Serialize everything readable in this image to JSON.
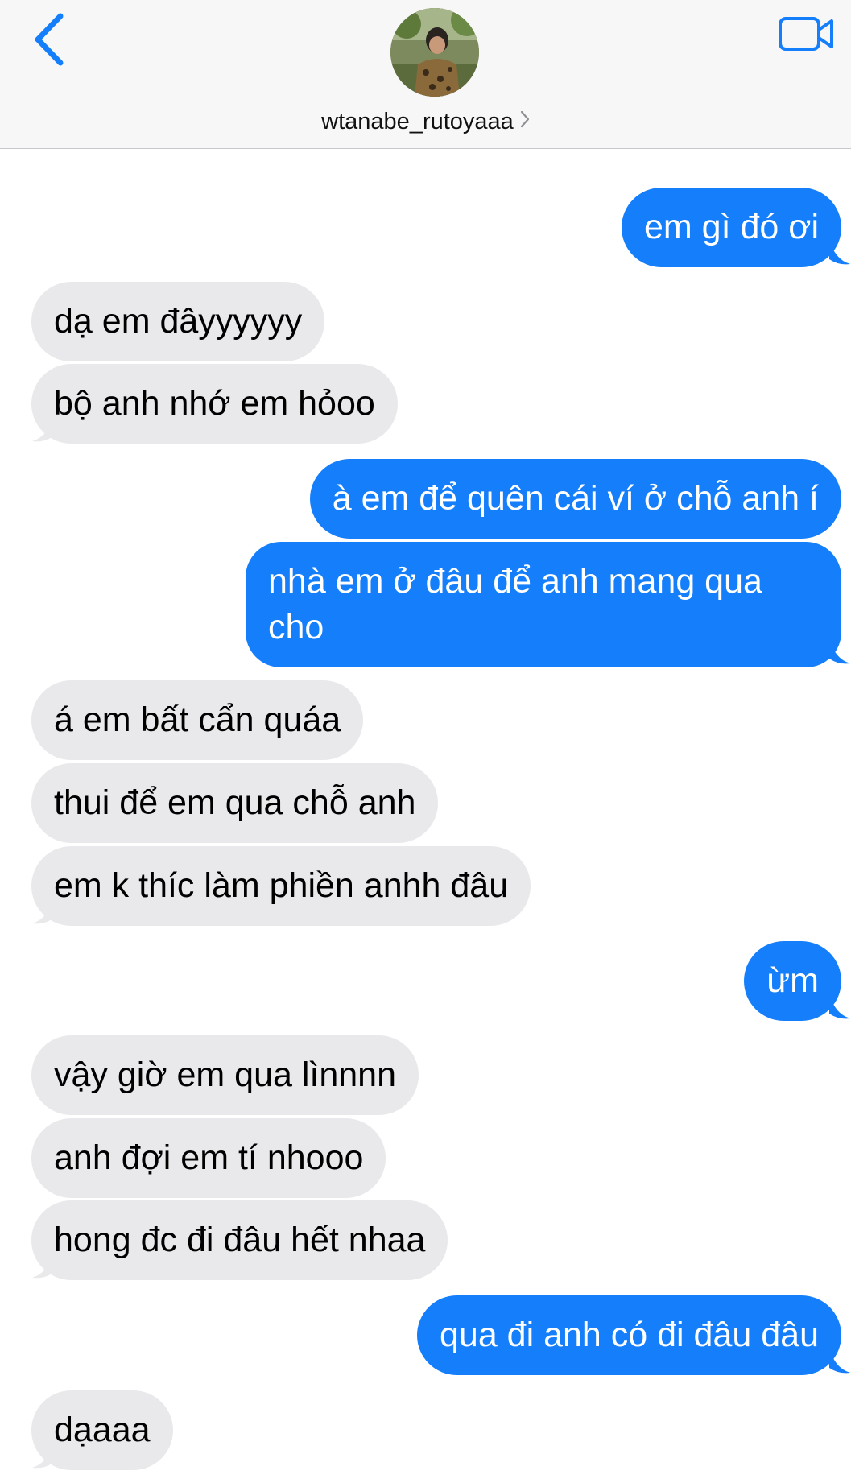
{
  "header": {
    "contact_name": "wtanabe_rutoyaaa",
    "back_icon": "chevron-left-icon",
    "video_icon": "video-camera-icon",
    "accent_color": "#147efb"
  },
  "messages": [
    {
      "side": "out",
      "text": "em gì đó ơi"
    },
    {
      "side": "in",
      "text": "dạ em đâyyyyyy"
    },
    {
      "side": "in",
      "text": "bộ anh nhớ em hỏoo"
    },
    {
      "side": "out",
      "text": "à em để quên cái ví ở chỗ anh í"
    },
    {
      "side": "out",
      "text": "nhà em ở đâu để anh mang qua cho"
    },
    {
      "side": "in",
      "text": "á em bất cẩn quáa"
    },
    {
      "side": "in",
      "text": "thui để em qua chỗ anh"
    },
    {
      "side": "in",
      "text": "em k thíc làm phiền anhh đâu"
    },
    {
      "side": "out",
      "text": "ừm"
    },
    {
      "side": "in",
      "text": "vậy giờ em qua lìnnnn"
    },
    {
      "side": "in",
      "text": "anh đợi em tí nhooo"
    },
    {
      "side": "in",
      "text": "hong đc đi đâu hết nhaa"
    },
    {
      "side": "out",
      "text": "qua đi anh có đi đâu đâu"
    },
    {
      "side": "in",
      "text": "dạaaa"
    }
  ]
}
